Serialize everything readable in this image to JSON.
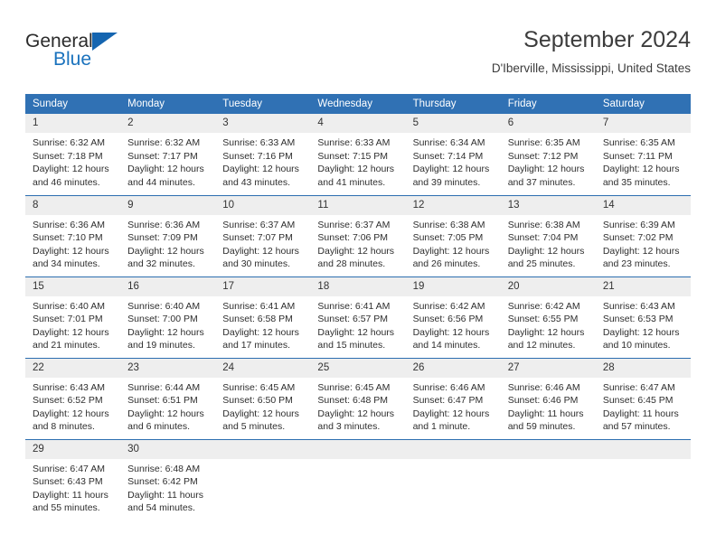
{
  "brand": {
    "name_part1": "General",
    "name_part2": "Blue",
    "triangle_color": "#1565b0",
    "blue_color": "#1a72bd"
  },
  "header": {
    "title": "September 2024",
    "subtitle": "D'Iberville, Mississippi, United States"
  },
  "theme": {
    "header_bg": "#3071b4",
    "row_divider": "#2c6eb0",
    "daynum_bg": "#eeeeee",
    "text": "#2e2e2e"
  },
  "weekday_headers": [
    "Sunday",
    "Monday",
    "Tuesday",
    "Wednesday",
    "Thursday",
    "Friday",
    "Saturday"
  ],
  "labels": {
    "sunrise_prefix": "Sunrise:",
    "sunset_prefix": "Sunset:",
    "daylight_prefix": "Daylight:"
  },
  "weeks": [
    [
      {
        "day": "1",
        "sunrise": "Sunrise: 6:32 AM",
        "sunset": "Sunset: 7:18 PM",
        "daylight1": "Daylight: 12 hours",
        "daylight2": "and 46 minutes."
      },
      {
        "day": "2",
        "sunrise": "Sunrise: 6:32 AM",
        "sunset": "Sunset: 7:17 PM",
        "daylight1": "Daylight: 12 hours",
        "daylight2": "and 44 minutes."
      },
      {
        "day": "3",
        "sunrise": "Sunrise: 6:33 AM",
        "sunset": "Sunset: 7:16 PM",
        "daylight1": "Daylight: 12 hours",
        "daylight2": "and 43 minutes."
      },
      {
        "day": "4",
        "sunrise": "Sunrise: 6:33 AM",
        "sunset": "Sunset: 7:15 PM",
        "daylight1": "Daylight: 12 hours",
        "daylight2": "and 41 minutes."
      },
      {
        "day": "5",
        "sunrise": "Sunrise: 6:34 AM",
        "sunset": "Sunset: 7:14 PM",
        "daylight1": "Daylight: 12 hours",
        "daylight2": "and 39 minutes."
      },
      {
        "day": "6",
        "sunrise": "Sunrise: 6:35 AM",
        "sunset": "Sunset: 7:12 PM",
        "daylight1": "Daylight: 12 hours",
        "daylight2": "and 37 minutes."
      },
      {
        "day": "7",
        "sunrise": "Sunrise: 6:35 AM",
        "sunset": "Sunset: 7:11 PM",
        "daylight1": "Daylight: 12 hours",
        "daylight2": "and 35 minutes."
      }
    ],
    [
      {
        "day": "8",
        "sunrise": "Sunrise: 6:36 AM",
        "sunset": "Sunset: 7:10 PM",
        "daylight1": "Daylight: 12 hours",
        "daylight2": "and 34 minutes."
      },
      {
        "day": "9",
        "sunrise": "Sunrise: 6:36 AM",
        "sunset": "Sunset: 7:09 PM",
        "daylight1": "Daylight: 12 hours",
        "daylight2": "and 32 minutes."
      },
      {
        "day": "10",
        "sunrise": "Sunrise: 6:37 AM",
        "sunset": "Sunset: 7:07 PM",
        "daylight1": "Daylight: 12 hours",
        "daylight2": "and 30 minutes."
      },
      {
        "day": "11",
        "sunrise": "Sunrise: 6:37 AM",
        "sunset": "Sunset: 7:06 PM",
        "daylight1": "Daylight: 12 hours",
        "daylight2": "and 28 minutes."
      },
      {
        "day": "12",
        "sunrise": "Sunrise: 6:38 AM",
        "sunset": "Sunset: 7:05 PM",
        "daylight1": "Daylight: 12 hours",
        "daylight2": "and 26 minutes."
      },
      {
        "day": "13",
        "sunrise": "Sunrise: 6:38 AM",
        "sunset": "Sunset: 7:04 PM",
        "daylight1": "Daylight: 12 hours",
        "daylight2": "and 25 minutes."
      },
      {
        "day": "14",
        "sunrise": "Sunrise: 6:39 AM",
        "sunset": "Sunset: 7:02 PM",
        "daylight1": "Daylight: 12 hours",
        "daylight2": "and 23 minutes."
      }
    ],
    [
      {
        "day": "15",
        "sunrise": "Sunrise: 6:40 AM",
        "sunset": "Sunset: 7:01 PM",
        "daylight1": "Daylight: 12 hours",
        "daylight2": "and 21 minutes."
      },
      {
        "day": "16",
        "sunrise": "Sunrise: 6:40 AM",
        "sunset": "Sunset: 7:00 PM",
        "daylight1": "Daylight: 12 hours",
        "daylight2": "and 19 minutes."
      },
      {
        "day": "17",
        "sunrise": "Sunrise: 6:41 AM",
        "sunset": "Sunset: 6:58 PM",
        "daylight1": "Daylight: 12 hours",
        "daylight2": "and 17 minutes."
      },
      {
        "day": "18",
        "sunrise": "Sunrise: 6:41 AM",
        "sunset": "Sunset: 6:57 PM",
        "daylight1": "Daylight: 12 hours",
        "daylight2": "and 15 minutes."
      },
      {
        "day": "19",
        "sunrise": "Sunrise: 6:42 AM",
        "sunset": "Sunset: 6:56 PM",
        "daylight1": "Daylight: 12 hours",
        "daylight2": "and 14 minutes."
      },
      {
        "day": "20",
        "sunrise": "Sunrise: 6:42 AM",
        "sunset": "Sunset: 6:55 PM",
        "daylight1": "Daylight: 12 hours",
        "daylight2": "and 12 minutes."
      },
      {
        "day": "21",
        "sunrise": "Sunrise: 6:43 AM",
        "sunset": "Sunset: 6:53 PM",
        "daylight1": "Daylight: 12 hours",
        "daylight2": "and 10 minutes."
      }
    ],
    [
      {
        "day": "22",
        "sunrise": "Sunrise: 6:43 AM",
        "sunset": "Sunset: 6:52 PM",
        "daylight1": "Daylight: 12 hours",
        "daylight2": "and 8 minutes."
      },
      {
        "day": "23",
        "sunrise": "Sunrise: 6:44 AM",
        "sunset": "Sunset: 6:51 PM",
        "daylight1": "Daylight: 12 hours",
        "daylight2": "and 6 minutes."
      },
      {
        "day": "24",
        "sunrise": "Sunrise: 6:45 AM",
        "sunset": "Sunset: 6:50 PM",
        "daylight1": "Daylight: 12 hours",
        "daylight2": "and 5 minutes."
      },
      {
        "day": "25",
        "sunrise": "Sunrise: 6:45 AM",
        "sunset": "Sunset: 6:48 PM",
        "daylight1": "Daylight: 12 hours",
        "daylight2": "and 3 minutes."
      },
      {
        "day": "26",
        "sunrise": "Sunrise: 6:46 AM",
        "sunset": "Sunset: 6:47 PM",
        "daylight1": "Daylight: 12 hours",
        "daylight2": "and 1 minute."
      },
      {
        "day": "27",
        "sunrise": "Sunrise: 6:46 AM",
        "sunset": "Sunset: 6:46 PM",
        "daylight1": "Daylight: 11 hours",
        "daylight2": "and 59 minutes."
      },
      {
        "day": "28",
        "sunrise": "Sunrise: 6:47 AM",
        "sunset": "Sunset: 6:45 PM",
        "daylight1": "Daylight: 11 hours",
        "daylight2": "and 57 minutes."
      }
    ],
    [
      {
        "day": "29",
        "sunrise": "Sunrise: 6:47 AM",
        "sunset": "Sunset: 6:43 PM",
        "daylight1": "Daylight: 11 hours",
        "daylight2": "and 55 minutes."
      },
      {
        "day": "30",
        "sunrise": "Sunrise: 6:48 AM",
        "sunset": "Sunset: 6:42 PM",
        "daylight1": "Daylight: 11 hours",
        "daylight2": "and 54 minutes."
      },
      {
        "day": "",
        "sunrise": "",
        "sunset": "",
        "daylight1": "",
        "daylight2": ""
      },
      {
        "day": "",
        "sunrise": "",
        "sunset": "",
        "daylight1": "",
        "daylight2": ""
      },
      {
        "day": "",
        "sunrise": "",
        "sunset": "",
        "daylight1": "",
        "daylight2": ""
      },
      {
        "day": "",
        "sunrise": "",
        "sunset": "",
        "daylight1": "",
        "daylight2": ""
      },
      {
        "day": "",
        "sunrise": "",
        "sunset": "",
        "daylight1": "",
        "daylight2": ""
      }
    ]
  ]
}
